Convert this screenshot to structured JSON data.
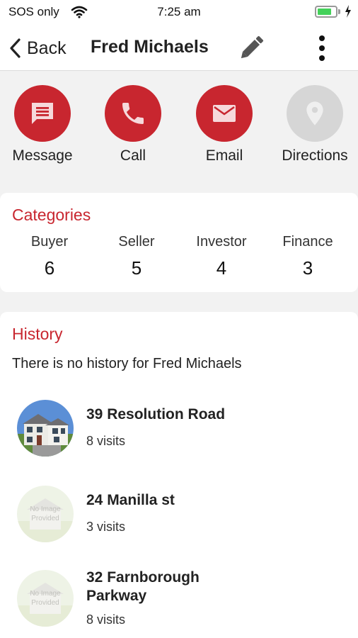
{
  "status": {
    "carrier": "SOS only",
    "time": "7:25 am",
    "battery_level": 0.8
  },
  "nav": {
    "back_label": "Back",
    "title": "Fred Michaels",
    "edit_icon": "pencil-icon",
    "more_icon": "more-vertical-icon"
  },
  "actions": [
    {
      "label": "Message",
      "icon": "message-icon",
      "enabled": true
    },
    {
      "label": "Call",
      "icon": "phone-icon",
      "enabled": true
    },
    {
      "label": "Email",
      "icon": "email-icon",
      "enabled": true
    },
    {
      "label": "Directions",
      "icon": "location-pin-icon",
      "enabled": false
    }
  ],
  "categories": {
    "title": "Categories",
    "items": [
      {
        "label": "Buyer",
        "count": "6"
      },
      {
        "label": "Seller",
        "count": "5"
      },
      {
        "label": "Investor",
        "count": "4"
      },
      {
        "label": "Finance",
        "count": "3"
      }
    ]
  },
  "history": {
    "title": "History",
    "empty_text": "There is no history for Fred Michaels",
    "placeholder_text": [
      "No Image",
      "Provided"
    ],
    "items": [
      {
        "title_lines": [
          "39 Resolution Road"
        ],
        "visits": "8 visits",
        "has_photo": true
      },
      {
        "title_lines": [
          "24 Manilla st"
        ],
        "visits": "3 visits",
        "has_photo": false
      },
      {
        "title_lines": [
          "32 Farnborough",
          "Parkway"
        ],
        "visits": "8 visits",
        "has_photo": false
      }
    ]
  },
  "colors": {
    "accent": "#c8262f",
    "disabled": "#d6d6d6",
    "action_icon": "#f6d9db"
  }
}
